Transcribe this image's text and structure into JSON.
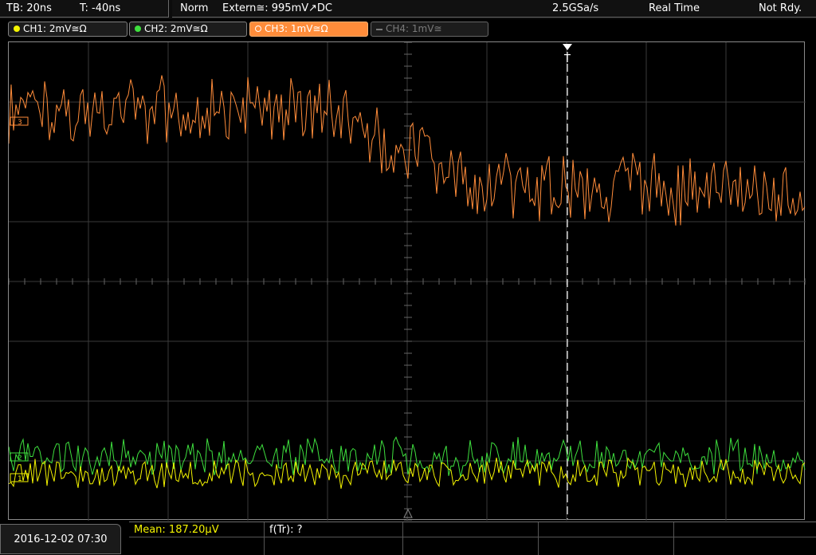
{
  "top_bar": {
    "timebase": "TB: 20ns",
    "trigger_time": "T: -40ns",
    "trigger_mode": "Norm",
    "trigger_source": "Extern≅: 995mV",
    "trigger_slope": "↗DC",
    "sample_rate": "2.5GSa/s",
    "acq_mode": "Real Time",
    "status": "Not Rdy."
  },
  "channels": [
    {
      "label": "CH1: 2mV≅Ω",
      "color": "#f4f400",
      "active": true
    },
    {
      "label": "CH2: 2mV≅Ω",
      "color": "#3ee03e",
      "active": true
    },
    {
      "label": "CH3: 1mV≅Ω",
      "color": "#ff8c3a",
      "active": true,
      "selected": true
    },
    {
      "label": "CH4: 1mV≅",
      "color": "#7a7a7a",
      "active": false
    }
  ],
  "markers": {
    "trigger_label": "T",
    "ch1_marker": "1",
    "ch2_marker": "2",
    "ch3_marker": "3"
  },
  "measurements": {
    "mean": "Mean: 187.20µV",
    "ftr": "f(Tr): ?"
  },
  "datetime": "2016-12-02 07:30",
  "colors": {
    "ch1": "#f4f400",
    "ch2": "#3ee03e",
    "ch3": "#ff8c3a",
    "grid": "#3a3a3a",
    "background": "#000000"
  }
}
